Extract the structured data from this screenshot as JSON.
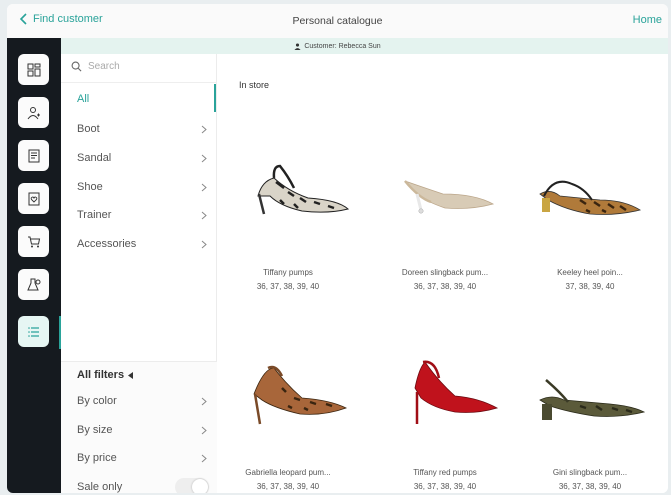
{
  "topbar": {
    "back_label": "Find customer",
    "title": "Personal catalogue",
    "home_label": "Home"
  },
  "customer": {
    "label": "Customer: Rebecca Sun"
  },
  "rail": {
    "items": [
      "dashboard-icon",
      "client-icon",
      "notes-icon",
      "wishlist-icon",
      "cart-icon",
      "appointment-icon",
      "catalogue-list-icon"
    ],
    "active_index": 6
  },
  "search": {
    "placeholder": "Search"
  },
  "categories": [
    {
      "label": "All",
      "active": true
    },
    {
      "label": "Boot"
    },
    {
      "label": "Sandal"
    },
    {
      "label": "Shoe"
    },
    {
      "label": "Trainer"
    },
    {
      "label": "Accessories"
    }
  ],
  "filters": {
    "title": "All filters",
    "rows": [
      {
        "label": "By color"
      },
      {
        "label": "By size"
      },
      {
        "label": "By price"
      }
    ],
    "sale_only": {
      "label": "Sale only",
      "on": false
    }
  },
  "section": {
    "title": "In store"
  },
  "products": [
    {
      "name": "Tiffany pumps",
      "sizes": "36, 37, 38, 39, 40"
    },
    {
      "name": "Doreen slingback pum...",
      "sizes": "36, 37, 38, 39, 40"
    },
    {
      "name": "Keeley heel poin...",
      "sizes": "37, 38, 39, 40"
    },
    {
      "name": "Gabriella leopard pum...",
      "sizes": "36, 37, 38, 39, 40"
    },
    {
      "name": "Tiffany red pumps",
      "sizes": "36, 37, 38, 39, 40"
    },
    {
      "name": "Gini slingback pum...",
      "sizes": "36, 37, 38, 39, 40"
    }
  ],
  "colors": {
    "accent": "#2aa39a",
    "rail": "#151a1f",
    "strip": "#e4f3ef"
  }
}
